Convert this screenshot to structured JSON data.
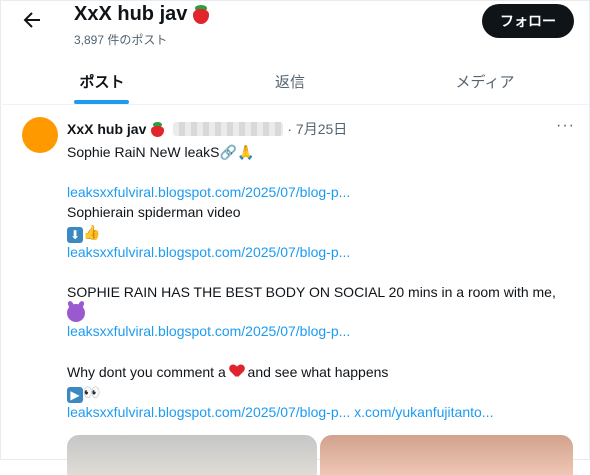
{
  "header": {
    "title": "XxX hub jav",
    "post_count": "3,897 件のポスト",
    "follow_label": "フォロー"
  },
  "tabs": [
    {
      "label": "ポスト",
      "active": true
    },
    {
      "label": "返信",
      "active": false
    },
    {
      "label": "メディア",
      "active": false
    }
  ],
  "post": {
    "author": "XxX hub jav",
    "date": "· 7月25日",
    "more": "···",
    "lines": {
      "l1": "Sophie RaiN NeW leakS",
      "link1": "leaksxxfulviral.blogspot.com/2025/07/blog-p...",
      "l2": "Sophierain spiderman video",
      "link2": "leaksxxfulviral.blogspot.com/2025/07/blog-p...",
      "l3": "SOPHIE RAIN HAS THE BEST BODY ON SOCIAL 20 mins in a room with me,",
      "link3": "leaksxxfulviral.blogspot.com/2025/07/blog-p...",
      "l4a": "Why dont you comment a",
      "l4b": "and see what happens",
      "link4": "leaksxxfulviral.blogspot.com/2025/07/blog-p...",
      "link5": "x.com/yukanfujitanto..."
    }
  },
  "colors": {
    "accent": "#1d9bf0",
    "follow_bg": "#0f1419",
    "avatar": "#ff9900"
  }
}
